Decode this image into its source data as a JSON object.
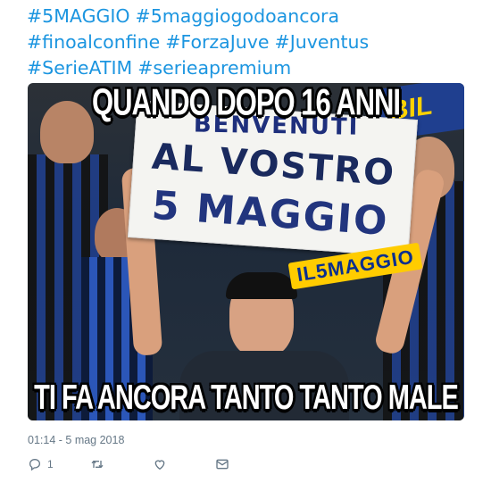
{
  "tweet": {
    "hashtag_lines": [
      [
        "#5MAGGIO",
        "#5maggiogodoancora"
      ],
      [
        "#finoalconfine",
        "#ForzaJuve",
        "#Juventus"
      ],
      [
        "#SerieATIM",
        "#serieapremium"
      ]
    ],
    "timestamp": "01:14 - 5 mag 2018"
  },
  "media": {
    "caption_top": "QUANDO DOPO 16 ANNI",
    "caption_bottom": "TI FA ANCORA TANTO TANTO MALE",
    "banner_lines": [
      "BENVENUTI",
      "AL VOSTRO",
      "5 MAGGIO"
    ],
    "badge_text": "IL5MAGGIO",
    "corner_text": "BIL"
  },
  "actions": {
    "reply_count": "1",
    "reply_icon": "reply-icon",
    "retweet_icon": "retweet-icon",
    "like_icon": "heart-icon",
    "dm_icon": "envelope-icon"
  }
}
